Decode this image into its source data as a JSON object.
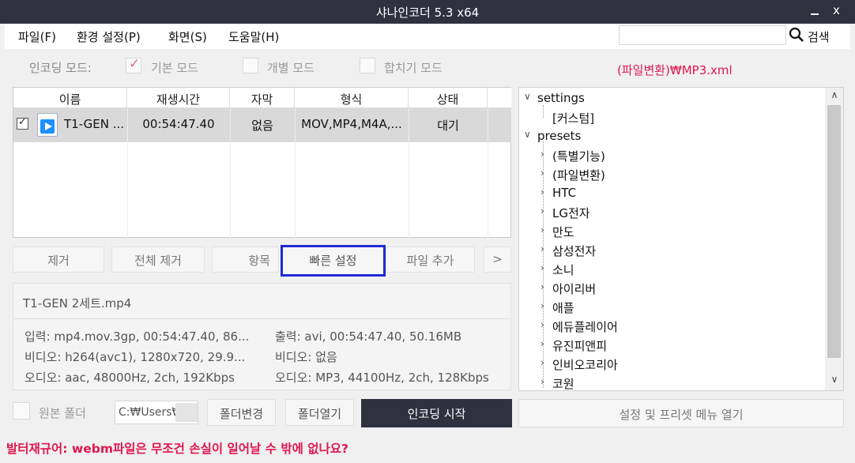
{
  "window": {
    "title": "샤나인코더  5.3  x64",
    "close_glyph": "x"
  },
  "menu": {
    "items": [
      "파일(F)",
      "환경 설정(P)",
      "화면(S)",
      "도움말(H)"
    ],
    "search_label": "검색",
    "search_value": ""
  },
  "mode": {
    "label": "인코딩 모드:",
    "options": [
      "기본 모드",
      "개별 모드",
      "합치기 모드"
    ],
    "selected": "기본 모드"
  },
  "preset_path": "(파일변환)₩MP3.xml",
  "file_list": {
    "headers": [
      "이름",
      "재생시간",
      "자막",
      "형식",
      "상태"
    ],
    "rows": [
      {
        "name": "T1-GEN ...",
        "duration": "00:54:47.40",
        "subtitle": "없음",
        "format": "MOV,MP4,M4A,...",
        "status": "대기",
        "checked": true
      }
    ]
  },
  "list_buttons": {
    "remove": "제거",
    "remove_all": "전체 제거",
    "item": "항목",
    "quick_settings": "빠른 설정",
    "add_file": "파일 추가",
    "more": ">"
  },
  "info": {
    "filename": "T1-GEN 2세트.mp4",
    "input": "입력: mp4.mov.3gp, 00:54:47.40, 86...",
    "output": "출력: avi, 00:54:47.40, 50.16MB",
    "video_in": "비디오: h264(avc1), 1280x720, 29.9...",
    "video_out": "비디오: 없음",
    "audio_in": "오디오: aac, 48000Hz, 2ch, 192Kbps",
    "audio_out": "오디오: MP3, 44100Hz, 2ch, 128Kbps"
  },
  "tree": {
    "settings": "settings",
    "custom": "[커스텀]",
    "presets": "presets",
    "items": [
      "(특별기능)",
      "(파일변환)",
      "HTC",
      "LG전자",
      "만도",
      "삼성전자",
      "소니",
      "아이리버",
      "애플",
      "에듀플레이어",
      "유진피앤피",
      "인비오코리아",
      "코원"
    ]
  },
  "bottom": {
    "original_folder": "원본 폴더",
    "path": "C:₩Users₩",
    "change_folder": "폴더변경",
    "open_folder": "폴더열기",
    "encode": "인코딩 시작",
    "settings_menu": "설정 및 프리셋 메뉴 열기"
  },
  "tip": "발터재규어: webm파일은 무조건 손실이 일어날 수 밖에 없나요?",
  "colors": {
    "titlebar": "#2f3140",
    "accent_red": "#e0164f",
    "highlight_border": "#1f2bd6"
  }
}
